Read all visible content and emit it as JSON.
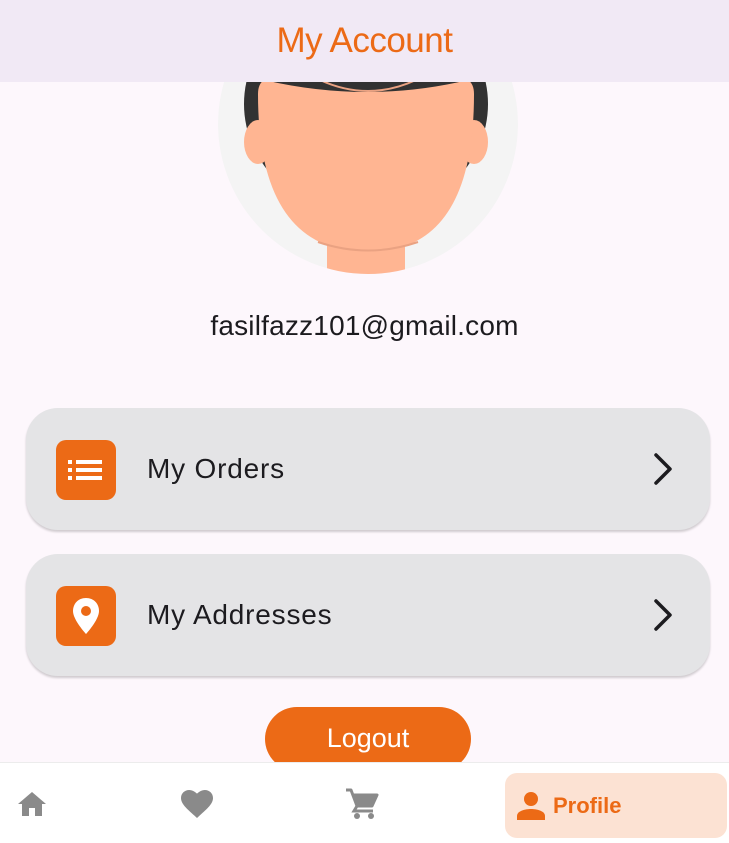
{
  "appbar": {
    "title": "My Account"
  },
  "profile": {
    "email": "fasilfazz101@gmail.com"
  },
  "menu": {
    "items": [
      {
        "label": "My Orders",
        "icon": "list-icon"
      },
      {
        "label": "My Addresses",
        "icon": "location-pin-icon"
      }
    ]
  },
  "logout": {
    "label": "Logout"
  },
  "navbar": {
    "items": [
      {
        "icon": "home-icon",
        "label": ""
      },
      {
        "icon": "heart-icon",
        "label": ""
      },
      {
        "icon": "cart-icon",
        "label": ""
      },
      {
        "icon": "person-icon",
        "label": "Profile"
      }
    ],
    "active_label": "Profile"
  },
  "colors": {
    "accent": "#ec6a16",
    "appbar_bg": "#f1e9f5",
    "card_bg": "#e4e4e6",
    "active_nav_bg": "#fce2d3",
    "inactive_icon": "#8a8a8a"
  }
}
